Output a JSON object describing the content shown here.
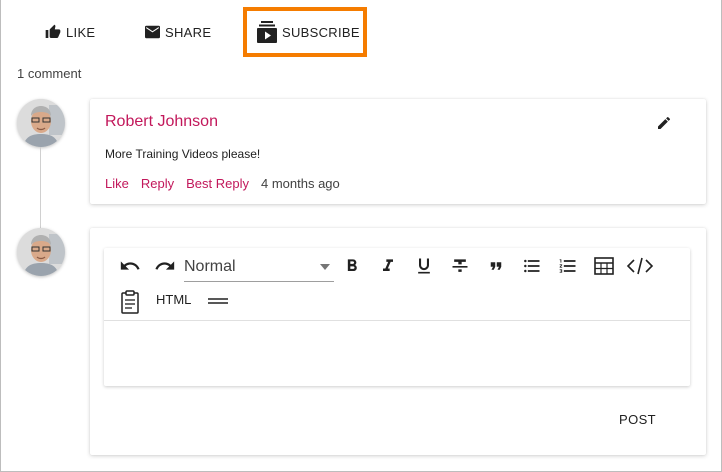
{
  "actions": {
    "like_label": "LIKE",
    "share_label": "SHARE",
    "subscribe_label": "SUBSCRIBE"
  },
  "comments_count_text": "1 comment",
  "comment": {
    "author": "Robert Johnson",
    "text": "More Training Videos please!",
    "like_label": "Like",
    "reply_label": "Reply",
    "best_reply_label": "Best Reply",
    "time": "4 months ago"
  },
  "editor": {
    "format_value": "Normal",
    "html_label": "HTML",
    "post_label": "POST",
    "icons": [
      "undo-icon",
      "redo-icon",
      "bold-icon",
      "italic-icon",
      "underline-icon",
      "strikethrough-icon",
      "quote-icon",
      "bullet-list-icon",
      "numbered-list-icon",
      "table-icon",
      "code-icon",
      "clipboard-icon",
      "horizontal-rule-icon"
    ]
  },
  "colors": {
    "accent": "#c2185b",
    "highlight": "#f57c00"
  }
}
